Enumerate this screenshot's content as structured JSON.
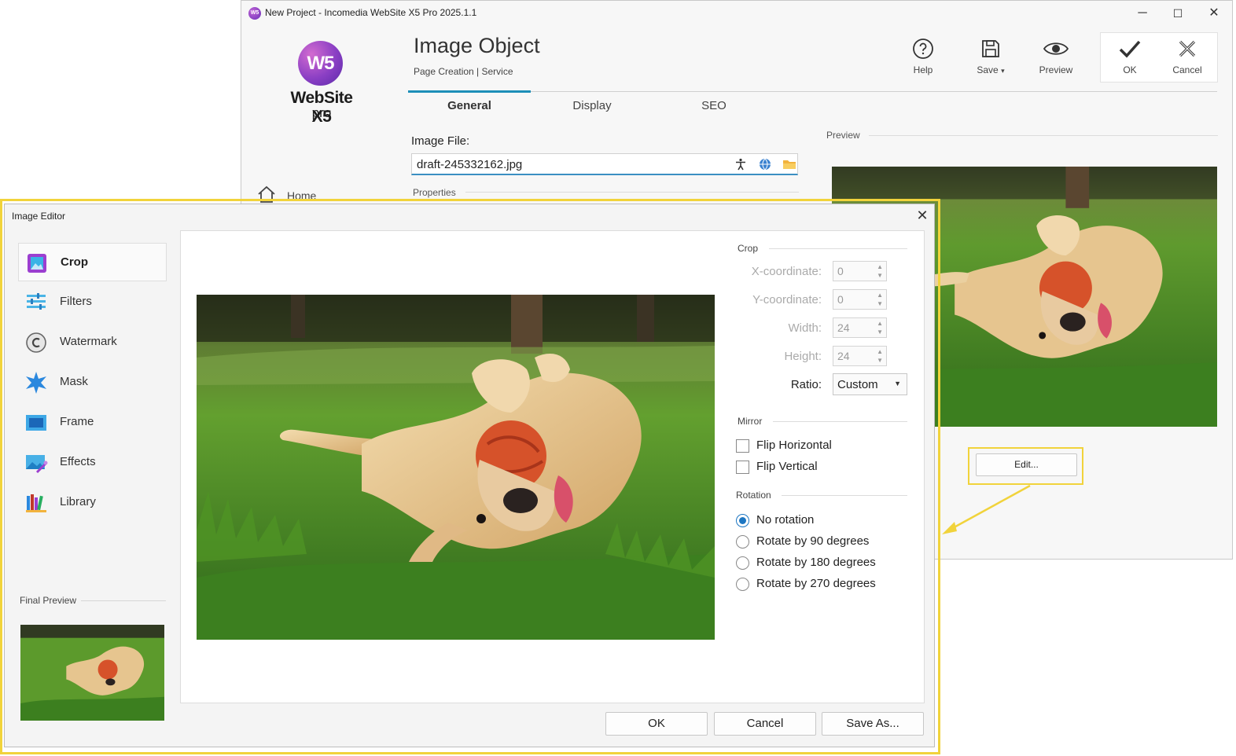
{
  "window": {
    "title": "New Project - Incomedia WebSite X5 Pro 2025.1.1",
    "app_icon_text": "W5",
    "minimize_glyph": "─",
    "maximize_glyph": "☐",
    "close_glyph": "✕"
  },
  "logo": {
    "mark": "W5",
    "name": "WebSite X5",
    "edition": "pro"
  },
  "header": {
    "title": "Image Object",
    "breadcrumb": "Page Creation | Service"
  },
  "toolbar": {
    "help": "Help",
    "save": "Save",
    "save_caret": "▾",
    "preview": "Preview",
    "ok": "OK",
    "cancel": "Cancel"
  },
  "tabs": [
    {
      "label": "General",
      "active": true
    },
    {
      "label": "Display",
      "active": false
    },
    {
      "label": "SEO",
      "active": false
    }
  ],
  "image_file": {
    "label": "Image File:",
    "value": "draft-245332162.jpg",
    "icons": [
      "accessibility-icon",
      "globe-icon",
      "folder-icon"
    ]
  },
  "properties_label": "Properties",
  "nav": {
    "home": "Home"
  },
  "preview": {
    "label": "Preview",
    "edit_button": "Edit..."
  },
  "image_editor": {
    "title": "Image Editor",
    "close_glyph": "✕",
    "sidebar": [
      {
        "label": "Crop",
        "icon": "crop-icon",
        "active": true
      },
      {
        "label": "Filters",
        "icon": "filters-icon",
        "active": false
      },
      {
        "label": "Watermark",
        "icon": "watermark-icon",
        "active": false
      },
      {
        "label": "Mask",
        "icon": "mask-icon",
        "active": false
      },
      {
        "label": "Frame",
        "icon": "frame-icon",
        "active": false
      },
      {
        "label": "Effects",
        "icon": "effects-icon",
        "active": false
      },
      {
        "label": "Library",
        "icon": "library-icon",
        "active": false
      }
    ],
    "final_preview_label": "Final Preview",
    "crop": {
      "label": "Crop",
      "x_label": "X-coordinate:",
      "x_value": "0",
      "y_label": "Y-coordinate:",
      "y_value": "0",
      "width_label": "Width:",
      "width_value": "24",
      "height_label": "Height:",
      "height_value": "24",
      "ratio_label": "Ratio:",
      "ratio_value": "Custom"
    },
    "mirror": {
      "label": "Mirror",
      "flip_horizontal": "Flip Horizontal",
      "flip_vertical": "Flip Vertical"
    },
    "rotation": {
      "label": "Rotation",
      "options": [
        "No rotation",
        "Rotate by 90 degrees",
        "Rotate by 180 degrees",
        "Rotate by 270 degrees"
      ],
      "selected": 0
    },
    "buttons": {
      "ok": "OK",
      "cancel": "Cancel",
      "save_as": "Save As..."
    }
  },
  "colors": {
    "highlight": "#f1d33b",
    "accent": "#1d8fb8",
    "radio": "#1d76c2"
  }
}
